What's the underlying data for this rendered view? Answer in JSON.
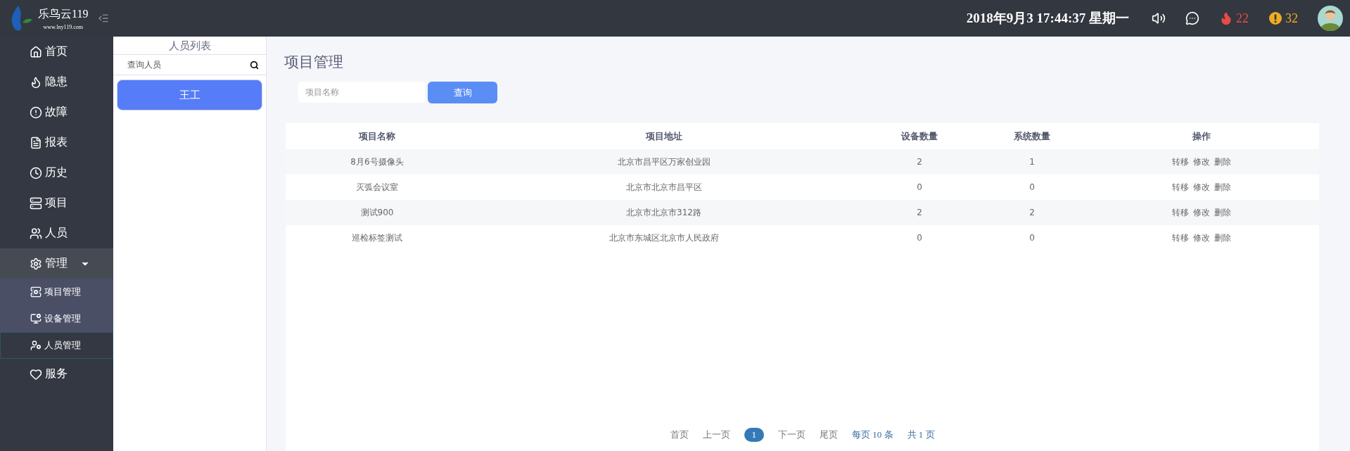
{
  "header": {
    "logo_title": "乐鸟云119",
    "logo_url": "www.lny119.com",
    "datetime": "2018年9月3 17:44:37 星期一",
    "alerts": [
      {
        "kind": "fire",
        "count": "22"
      },
      {
        "kind": "warning",
        "count": "32"
      }
    ]
  },
  "nav": [
    {
      "label": "首页"
    },
    {
      "label": "隐患"
    },
    {
      "label": "故障"
    },
    {
      "label": "报表"
    },
    {
      "label": "历史"
    },
    {
      "label": "项目"
    },
    {
      "label": "人员"
    },
    {
      "label": "管理",
      "expanded": true,
      "children": [
        {
          "label": "项目管理",
          "selected": false
        },
        {
          "label": "设备管理",
          "selected": false
        },
        {
          "label": "人员管理",
          "selected": true
        }
      ]
    },
    {
      "label": "服务"
    }
  ],
  "person_panel": {
    "title": "人员列表",
    "search": {
      "placeholder": "查询人员"
    },
    "people": [
      {
        "name": "王工",
        "selected": true
      }
    ]
  },
  "main": {
    "title": "项目管理",
    "search": {
      "placeholder": "项目名称"
    },
    "search_button": "查询",
    "table": {
      "columns": [
        "项目名称",
        "项目地址",
        "设备数量",
        "系统数量",
        "操作"
      ],
      "rows": [
        {
          "cells": [
            "8月6号摄像头",
            "北京市昌平区万家创业园",
            "2",
            "1"
          ],
          "actions": [
            "转移",
            "修改",
            "删除"
          ]
        },
        {
          "cells": [
            "灭弧会议室",
            "北京市北京市昌平区",
            "0",
            "0"
          ],
          "actions": [
            "转移",
            "修改",
            "删除"
          ]
        },
        {
          "cells": [
            "测试900",
            "北京市北京市312路",
            "2",
            "2"
          ],
          "actions": [
            "转移",
            "修改",
            "删除"
          ]
        },
        {
          "cells": [
            "巡检标签测试",
            "北京市东城区北京市人民政府",
            "0",
            "0"
          ],
          "actions": [
            "转移",
            "修改",
            "删除"
          ]
        }
      ]
    },
    "pagination": {
      "first": "首页",
      "prev": "上一页",
      "pages": [
        {
          "label": "1",
          "selected": true
        }
      ],
      "next": "下一页",
      "last": "尾页",
      "page_size": "每页 10 条",
      "total": "共 1 页"
    }
  }
}
